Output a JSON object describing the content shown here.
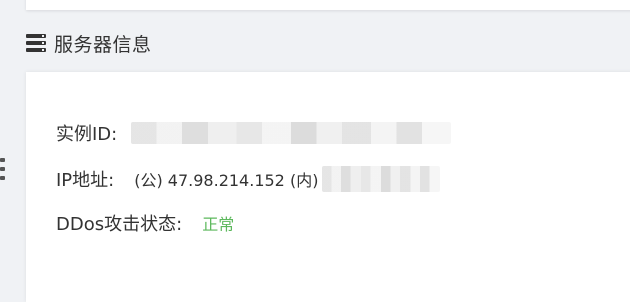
{
  "section": {
    "title": "服务器信息",
    "icon": "server-icon"
  },
  "info": {
    "instance_label": "实例ID:",
    "ip_label": "IP地址:",
    "ip_value": "(公) 47.98.214.152 (内)",
    "ddos_label": "DDos攻击状态:",
    "ddos_status": "正常",
    "ddos_status_color": "#5cb85c"
  }
}
